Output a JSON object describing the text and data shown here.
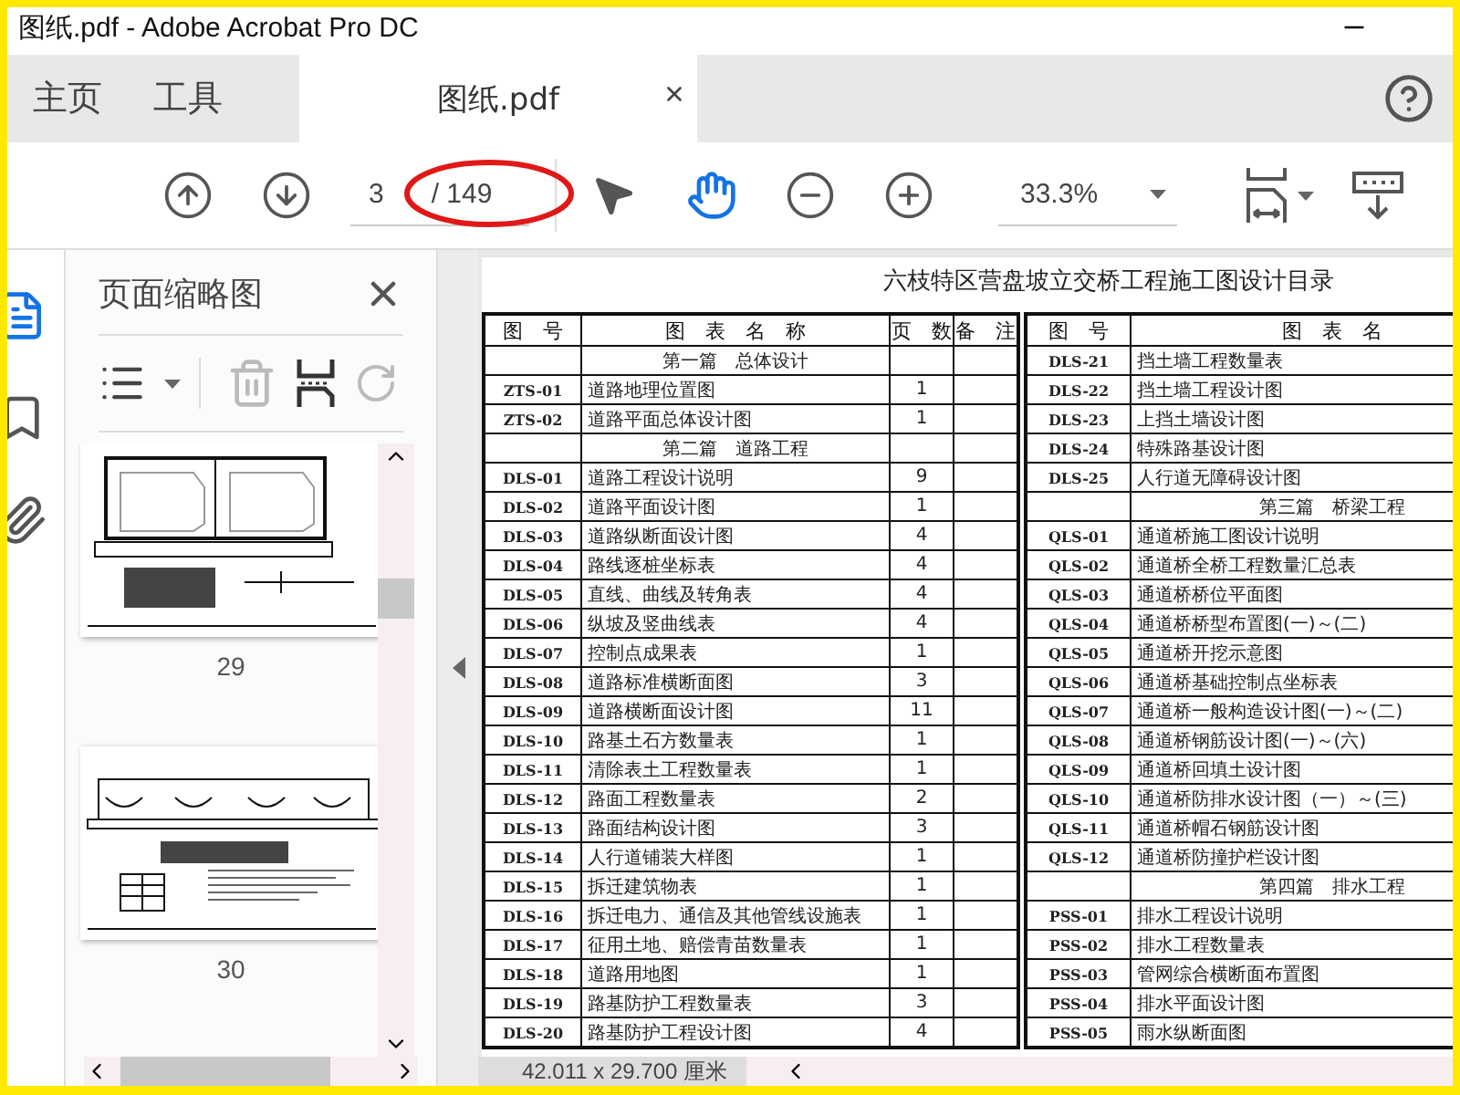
{
  "window": {
    "title": "图纸.pdf - Adobe Acrobat Pro DC"
  },
  "tabs": [
    {
      "label": "主页",
      "selected": false,
      "kind": "nav"
    },
    {
      "label": "工具",
      "selected": false,
      "kind": "nav"
    },
    {
      "label": "图纸.pdf",
      "selected": true,
      "kind": "document"
    }
  ],
  "toolbar": {
    "page": "3",
    "page_count": "/ 149",
    "zoom": "33.3%",
    "tools": [
      {
        "kind": "pointer",
        "selected": false
      },
      {
        "kind": "hand",
        "selected": true
      }
    ]
  },
  "markup": {
    "kind": "ellipse"
  },
  "sidebar": {
    "rail": [
      {
        "kind": "pages",
        "selected": true
      },
      {
        "kind": "bookmark",
        "selected": false
      },
      {
        "kind": "attachment",
        "selected": false
      }
    ],
    "title": "页面缩略图",
    "thumbnails": [
      {
        "label": "29",
        "kind": "box-section"
      },
      {
        "label": "30",
        "kind": "multi-section"
      }
    ]
  },
  "document": {
    "title": "六枝特区营盘坡立交桥工程施工图设计目录",
    "tables": [
      {
        "columns": [
          "图　号",
          "图　表　名　称",
          "页　数",
          "备　注"
        ],
        "rows": [
          {
            "kind": "section",
            "name": "第一篇　总体设计"
          },
          {
            "kind": "entry",
            "code": "ZTS-01",
            "name": "道路地理位置图",
            "pages": "1"
          },
          {
            "kind": "entry",
            "code": "ZTS-02",
            "name": "道路平面总体设计图",
            "pages": "1"
          },
          {
            "kind": "section",
            "name": "第二篇　道路工程"
          },
          {
            "kind": "entry",
            "code": "DLS-01",
            "name": "道路工程设计说明",
            "pages": "9"
          },
          {
            "kind": "entry",
            "code": "DLS-02",
            "name": "道路平面设计图",
            "pages": "1"
          },
          {
            "kind": "entry",
            "code": "DLS-03",
            "name": "道路纵断面设计图",
            "pages": "4"
          },
          {
            "kind": "entry",
            "code": "DLS-04",
            "name": "路线逐桩坐标表",
            "pages": "4"
          },
          {
            "kind": "entry",
            "code": "DLS-05",
            "name": "直线、曲线及转角表",
            "pages": "4"
          },
          {
            "kind": "entry",
            "code": "DLS-06",
            "name": "纵坡及竖曲线表",
            "pages": "4"
          },
          {
            "kind": "entry",
            "code": "DLS-07",
            "name": "控制点成果表",
            "pages": "1"
          },
          {
            "kind": "entry",
            "code": "DLS-08",
            "name": "道路标准横断面图",
            "pages": "3"
          },
          {
            "kind": "entry",
            "code": "DLS-09",
            "name": "道路横断面设计图",
            "pages": "11"
          },
          {
            "kind": "entry",
            "code": "DLS-10",
            "name": "路基土石方数量表",
            "pages": "1"
          },
          {
            "kind": "entry",
            "code": "DLS-11",
            "name": "清除表土工程数量表",
            "pages": "1"
          },
          {
            "kind": "entry",
            "code": "DLS-12",
            "name": "路面工程数量表",
            "pages": "2"
          },
          {
            "kind": "entry",
            "code": "DLS-13",
            "name": "路面结构设计图",
            "pages": "3"
          },
          {
            "kind": "entry",
            "code": "DLS-14",
            "name": "人行道铺装大样图",
            "pages": "1"
          },
          {
            "kind": "entry",
            "code": "DLS-15",
            "name": "拆迁建筑物表",
            "pages": "1"
          },
          {
            "kind": "entry",
            "code": "DLS-16",
            "name": "拆迁电力、通信及其他管线设施表",
            "pages": "1"
          },
          {
            "kind": "entry",
            "code": "DLS-17",
            "name": "征用土地、赔偿青苗数量表",
            "pages": "1"
          },
          {
            "kind": "entry",
            "code": "DLS-18",
            "name": "道路用地图",
            "pages": "1"
          },
          {
            "kind": "entry",
            "code": "DLS-19",
            "name": "路基防护工程数量表",
            "pages": "3"
          },
          {
            "kind": "entry",
            "code": "DLS-20",
            "name": "路基防护工程设计图",
            "pages": "4"
          }
        ]
      },
      {
        "columns": [
          "图　号",
          "图　表　名"
        ],
        "rows": [
          {
            "kind": "entry",
            "code": "DLS-21",
            "name": "挡土墙工程数量表"
          },
          {
            "kind": "entry",
            "code": "DLS-22",
            "name": "挡土墙工程设计图"
          },
          {
            "kind": "entry",
            "code": "DLS-23",
            "name": "上挡土墙设计图"
          },
          {
            "kind": "entry",
            "code": "DLS-24",
            "name": "特殊路基设计图"
          },
          {
            "kind": "entry",
            "code": "DLS-25",
            "name": "人行道无障碍设计图"
          },
          {
            "kind": "section",
            "name": "第三篇　桥梁工程"
          },
          {
            "kind": "entry",
            "code": "QLS-01",
            "name": "通道桥施工图设计说明"
          },
          {
            "kind": "entry",
            "code": "QLS-02",
            "name": "通道桥全桥工程数量汇总表"
          },
          {
            "kind": "entry",
            "code": "QLS-03",
            "name": "通道桥桥位平面图"
          },
          {
            "kind": "entry",
            "code": "QLS-04",
            "name": "通道桥桥型布置图(一)～(二)"
          },
          {
            "kind": "entry",
            "code": "QLS-05",
            "name": "通道桥开挖示意图"
          },
          {
            "kind": "entry",
            "code": "QLS-06",
            "name": "通道桥基础控制点坐标表"
          },
          {
            "kind": "entry",
            "code": "QLS-07",
            "name": "通道桥一般构造设计图(一)～(二)"
          },
          {
            "kind": "entry",
            "code": "QLS-08",
            "name": "通道桥钢筋设计图(一)～(六)"
          },
          {
            "kind": "entry",
            "code": "QLS-09",
            "name": "通道桥回填土设计图"
          },
          {
            "kind": "entry",
            "code": "QLS-10",
            "name": "通道桥防排水设计图（一）～(三)"
          },
          {
            "kind": "entry",
            "code": "QLS-11",
            "name": "通道桥帽石钢筋设计图"
          },
          {
            "kind": "entry",
            "code": "QLS-12",
            "name": "通道桥防撞护栏设计图"
          },
          {
            "kind": "section",
            "name": "第四篇　排水工程"
          },
          {
            "kind": "entry",
            "code": "PSS-01",
            "name": "排水工程设计说明"
          },
          {
            "kind": "entry",
            "code": "PSS-02",
            "name": "排水工程数量表"
          },
          {
            "kind": "entry",
            "code": "PSS-03",
            "name": "管网综合横断面布置图"
          },
          {
            "kind": "entry",
            "code": "PSS-04",
            "name": "排水平面设计图"
          },
          {
            "kind": "entry",
            "code": "PSS-05",
            "name": "雨水纵断面图"
          }
        ]
      }
    ]
  },
  "status_bar": {
    "page_size": "42.011 x 29.700 厘米"
  }
}
